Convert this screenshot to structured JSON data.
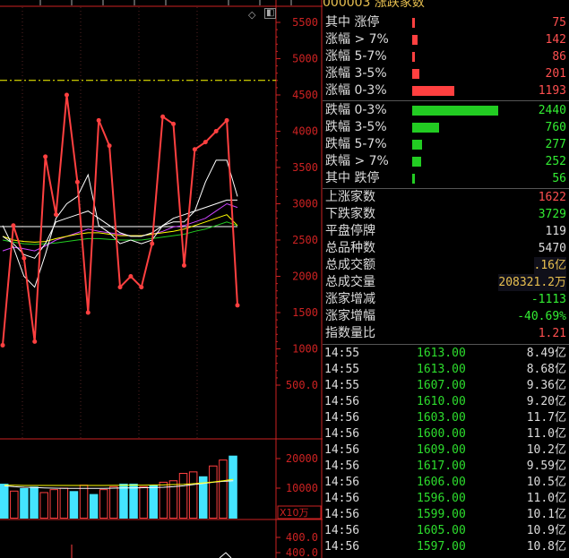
{
  "header": {
    "title": "000003 涨跌家数",
    "partial_menu": [
      "…",
      "…",
      "…",
      "…",
      "…"
    ]
  },
  "chart": {
    "price_axis_ticks": [
      "5500",
      "5000",
      "4500",
      "4000",
      "3500",
      "3000",
      "2500",
      "2000",
      "1500",
      "1000",
      "500.0"
    ],
    "volume_axis_ticks": [
      "20000",
      "10000"
    ],
    "volume_unit": "X10万",
    "lower_axis_tick": "400.0",
    "lower_axis_tick2": "400.0",
    "colors": {
      "red": "#ff4040",
      "white": "#ffffff",
      "yellow": "#ffff00",
      "cyan": "#44e4ff",
      "green": "#22cc22",
      "purple": "#cc44ff",
      "axis": "#cc2222"
    }
  },
  "stats": {
    "up_groups": [
      {
        "label": "其中 涨停",
        "value": "75"
      },
      {
        "label": "涨幅 > 7%",
        "value": "142"
      },
      {
        "label": "涨幅 5-7%",
        "value": "86"
      },
      {
        "label": "涨幅 3-5%",
        "value": "201"
      },
      {
        "label": "涨幅 0-3%",
        "value": "1193"
      }
    ],
    "down_groups": [
      {
        "label": "跌幅 0-3%",
        "value": "2440"
      },
      {
        "label": "跌幅 3-5%",
        "value": "760"
      },
      {
        "label": "跌幅 5-7%",
        "value": "277"
      },
      {
        "label": "跌幅 > 7%",
        "value": "252"
      },
      {
        "label": "其中 跌停",
        "value": "56"
      }
    ],
    "summary": [
      {
        "label": "上涨家数",
        "value": "1622",
        "color": "#ff5050"
      },
      {
        "label": "下跌家数",
        "value": "3729",
        "color": "#33ee33"
      },
      {
        "label": "平盘停牌",
        "value": "119",
        "color": "#dddddd"
      },
      {
        "label": "总品种数",
        "value": "5470",
        "color": "#dddddd"
      },
      {
        "label": "总成交额",
        "value": ".16亿",
        "color": "#e8c050"
      },
      {
        "label": "总成交量",
        "value": "208321.2万",
        "color": "#e8c050"
      },
      {
        "label": "涨家增减",
        "value": "-1113",
        "color": "#33ee33"
      },
      {
        "label": "涨家增幅",
        "value": "-40.69%",
        "color": "#33ee33"
      },
      {
        "label": "指数量比",
        "value": "1.21",
        "color": "#ff5050"
      }
    ]
  },
  "ticks": [
    {
      "time": "14:55",
      "price": "1613.00",
      "vol": "8.49亿"
    },
    {
      "time": "14:55",
      "price": "1613.00",
      "vol": "8.68亿"
    },
    {
      "time": "14:55",
      "price": "1607.00",
      "vol": "9.36亿"
    },
    {
      "time": "14:56",
      "price": "1610.00",
      "vol": "9.20亿"
    },
    {
      "time": "14:56",
      "price": "1603.00",
      "vol": "11.7亿"
    },
    {
      "time": "14:56",
      "price": "1600.00",
      "vol": "11.0亿"
    },
    {
      "time": "14:56",
      "price": "1609.00",
      "vol": "10.2亿"
    },
    {
      "time": "14:56",
      "price": "1617.00",
      "vol": "9.59亿"
    },
    {
      "time": "14:56",
      "price": "1606.00",
      "vol": "10.5亿"
    },
    {
      "time": "14:56",
      "price": "1596.00",
      "vol": "11.0亿"
    },
    {
      "time": "14:56",
      "price": "1599.00",
      "vol": "10.1亿"
    },
    {
      "time": "14:56",
      "price": "1605.00",
      "vol": "10.9亿"
    },
    {
      "time": "14:56",
      "price": "1597.00",
      "vol": "10.8亿"
    }
  ],
  "chart_data": {
    "type": "line",
    "price_series": [
      1050,
      2700,
      2250,
      1100,
      3650,
      2850,
      4500,
      3300,
      1500,
      4150,
      3800,
      1850,
      2000,
      1850,
      2450,
      4200,
      4100,
      2150,
      3750,
      3850,
      4000,
      4150,
      1600
    ],
    "ma_white1": [
      2700,
      2400,
      2000,
      1850,
      2300,
      2800,
      3000,
      3100,
      3400,
      2700,
      2600,
      2450,
      2500,
      2450,
      2500,
      2700,
      2750,
      2750,
      2900,
      3300,
      3600,
      3600,
      3100
    ],
    "ma_white2": [
      2550,
      2450,
      2300,
      2250,
      2450,
      2750,
      2800,
      2850,
      2900,
      2800,
      2700,
      2600,
      2550,
      2550,
      2600,
      2700,
      2800,
      2850,
      2900,
      2950,
      3000,
      3050,
      3050
    ],
    "ma_yellow": [
      2550,
      2500,
      2480,
      2470,
      2480,
      2520,
      2550,
      2580,
      2600,
      2600,
      2580,
      2560,
      2560,
      2560,
      2580,
      2600,
      2620,
      2650,
      2700,
      2750,
      2800,
      2850,
      2700
    ],
    "ma_purple": [
      2350,
      2400,
      2380,
      2350,
      2420,
      2500,
      2550,
      2600,
      2650,
      2620,
      2600,
      2580,
      2560,
      2560,
      2580,
      2620,
      2680,
      2700,
      2750,
      2800,
      2900,
      3000,
      2950
    ],
    "ma_green": [
      2500,
      2470,
      2450,
      2440,
      2450,
      2460,
      2480,
      2500,
      2520,
      2520,
      2510,
      2500,
      2500,
      2500,
      2520,
      2540,
      2560,
      2580,
      2620,
      2650,
      2700,
      2750,
      2700
    ],
    "reference_line": 4700,
    "volume_bars": [
      11500,
      9000,
      10000,
      10500,
      8500,
      9500,
      10000,
      9000,
      11000,
      8000,
      9500,
      10500,
      11500,
      11500,
      10500,
      11000,
      12000,
      12500,
      15000,
      15500,
      14000,
      17500,
      19500,
      21000
    ],
    "volume_bar_colors": [
      "cyan",
      "red",
      "cyan",
      "cyan",
      "red",
      "red",
      "red",
      "cyan",
      "red",
      "cyan",
      "red",
      "red",
      "cyan",
      "cyan",
      "red",
      "cyan",
      "red",
      "red",
      "red",
      "red",
      "cyan",
      "red",
      "red",
      "cyan"
    ],
    "volume_ma": [
      10800,
      10500,
      10300,
      10200,
      10100,
      10000,
      9900,
      9900,
      9900,
      9900,
      9950,
      10000,
      10050,
      10100,
      10150,
      10200,
      10300,
      10500,
      10800,
      11200,
      11600,
      12000,
      12300,
      12500
    ],
    "volume_ma2": [
      11000,
      11000,
      10900,
      10900,
      10900,
      10900,
      10900,
      10900,
      10900,
      10900,
      10900,
      10950,
      10950,
      11000,
      11000,
      11050,
      11100,
      11200,
      11300,
      11500,
      11800,
      12100,
      12500,
      13000
    ]
  }
}
